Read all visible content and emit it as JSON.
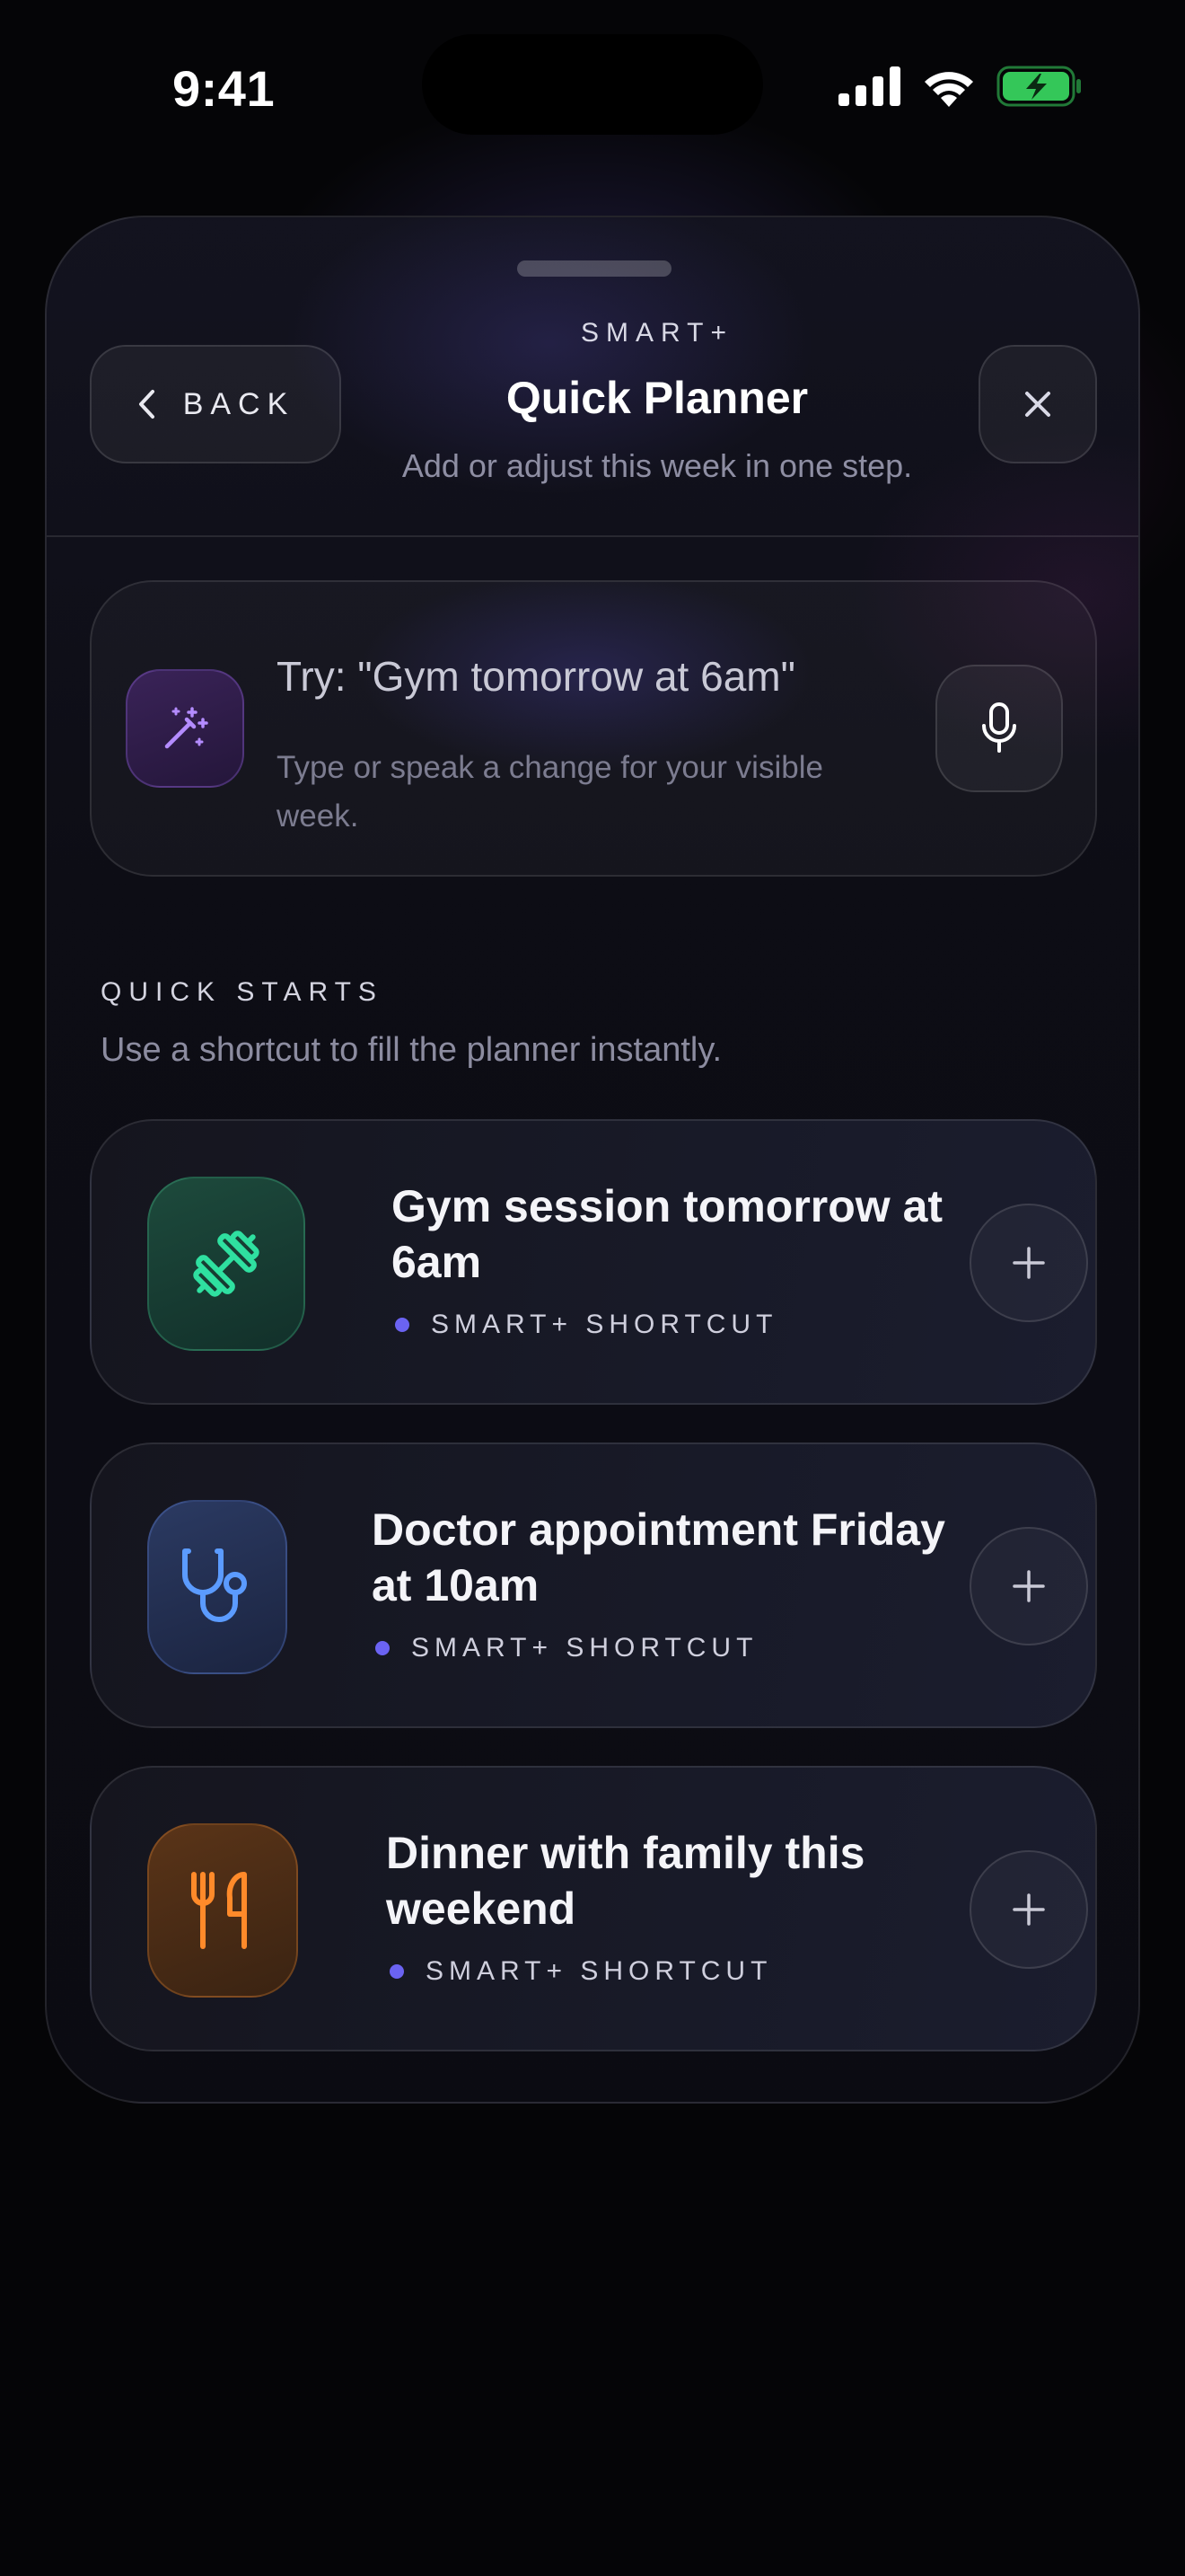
{
  "status_bar": {
    "time": "9:41",
    "icons": [
      "cellular-signal-icon",
      "wifi-icon",
      "battery-charging-icon"
    ],
    "battery_color": "#34c759"
  },
  "sheet": {
    "back_label": "BACK",
    "eyebrow": "SMART+",
    "title": "Quick Planner",
    "subtitle": "Add or adjust this week in one step."
  },
  "input": {
    "placeholder": "Try: \"Gym tomorrow at 6am\"",
    "value": "",
    "helper": "Type or speak a change for your visible week."
  },
  "quick_starts": {
    "label": "QUICK STARTS",
    "subtitle": "Use a shortcut to fill the planner instantly.",
    "items": [
      {
        "title": "Gym session tomorrow at 6am",
        "tag": "SMART+ SHORTCUT",
        "icon": "dumbbell-icon",
        "accent": "#2fe0a0"
      },
      {
        "title": "Doctor appointment Friday at 10am",
        "tag": "SMART+ SHORTCUT",
        "icon": "stethoscope-icon",
        "accent": "#5b9bff"
      },
      {
        "title": "Dinner with family this weekend",
        "tag": "SMART+ SHORTCUT",
        "icon": "utensils-icon",
        "accent": "#ff8a2a"
      }
    ]
  },
  "colors": {
    "background": "#050507",
    "accent_dot": "#6b63f2",
    "magic_icon": "#b48cff"
  }
}
